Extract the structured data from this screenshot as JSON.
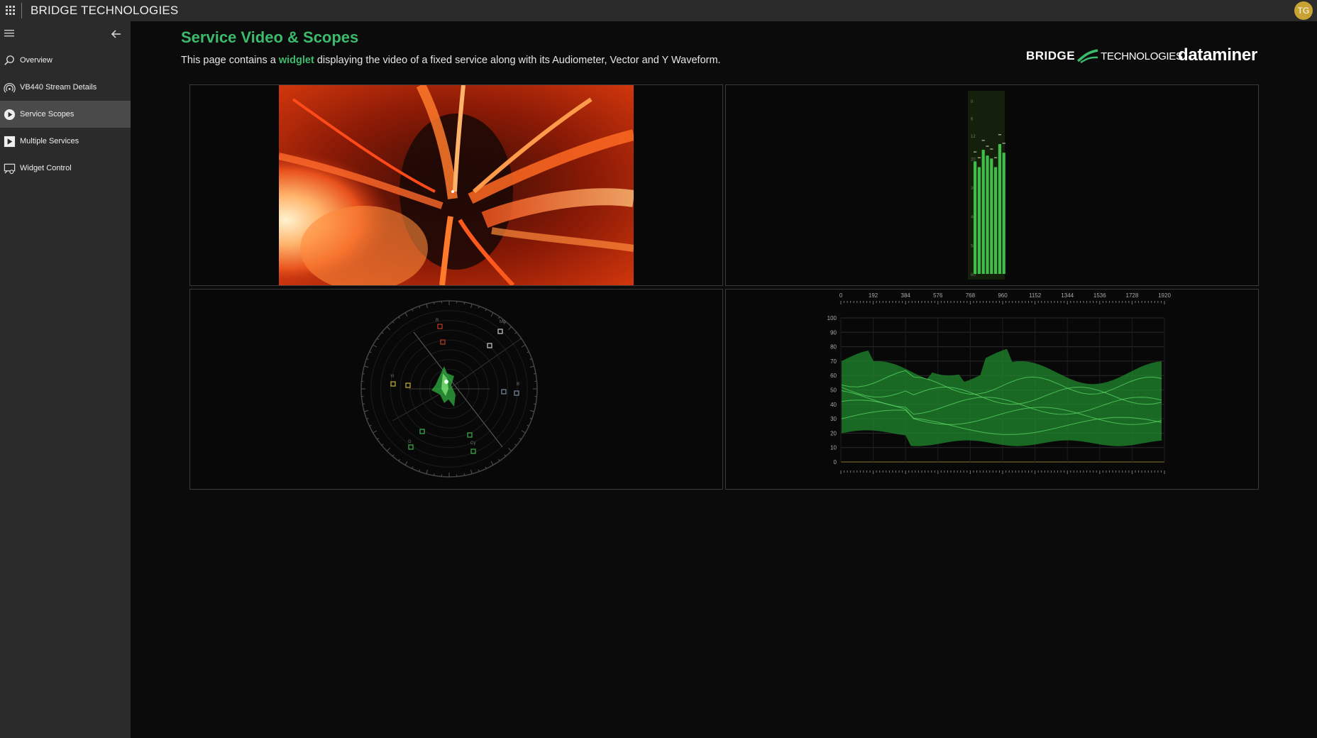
{
  "topbar": {
    "app_title": "BRIDGE TECHNOLOGIES",
    "avatar_initials": "TG",
    "avatar_color": "#c8a232"
  },
  "sidebar": {
    "items": [
      {
        "label": "Overview",
        "icon": "search-icon",
        "active": false
      },
      {
        "label": "VB440 Stream Details",
        "icon": "broadcast-icon",
        "active": false
      },
      {
        "label": "Service Scopes",
        "icon": "play-circle-icon",
        "active": true
      },
      {
        "label": "Multiple Services",
        "icon": "play-square-icon",
        "active": false
      },
      {
        "label": "Widget Control",
        "icon": "widget-control-icon",
        "active": false
      }
    ]
  },
  "main": {
    "title": "Service Video & Scopes",
    "description_before": "This page contains a ",
    "description_link": "widglet",
    "description_after": " displaying the video of a fixed service along with its Audiometer, Vector and Y Waveform.",
    "accent_color": "#3dbb6d"
  },
  "logos": {
    "bridge_left": "BRIDGE",
    "bridge_right": "TECHNOLOGIES",
    "dataminer": "dataminer"
  },
  "audiometer": {
    "scale": [
      "0",
      "6",
      "12",
      "20",
      "30",
      "40",
      "50",
      "60"
    ],
    "channel_levels_db": [
      -21,
      -23,
      -17,
      -19,
      -20,
      -23,
      -15,
      -18
    ]
  },
  "vectorscope": {
    "labels": [
      "R",
      "Mg",
      "B",
      "Cy",
      "G",
      "Yl"
    ]
  },
  "waveform": {
    "x_ticks": [
      "0",
      "192",
      "384",
      "576",
      "768",
      "960",
      "1152",
      "1344",
      "1536",
      "1728",
      "1920"
    ],
    "y_ticks": [
      "100",
      "90",
      "80",
      "70",
      "60",
      "50",
      "40",
      "30",
      "20",
      "10",
      "0"
    ]
  }
}
